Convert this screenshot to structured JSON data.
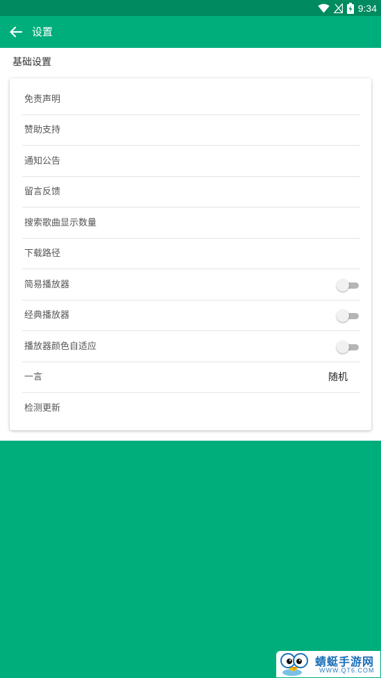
{
  "status_bar": {
    "time": "9:34"
  },
  "toolbar": {
    "title": "设置",
    "back_icon": "arrow-left-icon"
  },
  "settings": {
    "section_title": "基础设置",
    "items": [
      {
        "label": "免责声明"
      },
      {
        "label": "赞助支持"
      },
      {
        "label": "通知公告"
      },
      {
        "label": "留言反馈"
      },
      {
        "label": "搜索歌曲显示数量"
      },
      {
        "label": "下载路径"
      },
      {
        "label": "简易播放器",
        "toggle": false
      },
      {
        "label": "经典播放器",
        "toggle": false
      },
      {
        "label": "播放器颜色自适应",
        "toggle": false
      },
      {
        "label": "一言",
        "value": "随机"
      },
      {
        "label": "检测更新"
      }
    ]
  },
  "watermark": {
    "title": "蜻蜓手游网",
    "url": "WWW.QT6.COM"
  },
  "colors": {
    "primary": "#00ae7c",
    "status_bar": "#008a5f",
    "watermark_text": "#1a6fb8"
  }
}
